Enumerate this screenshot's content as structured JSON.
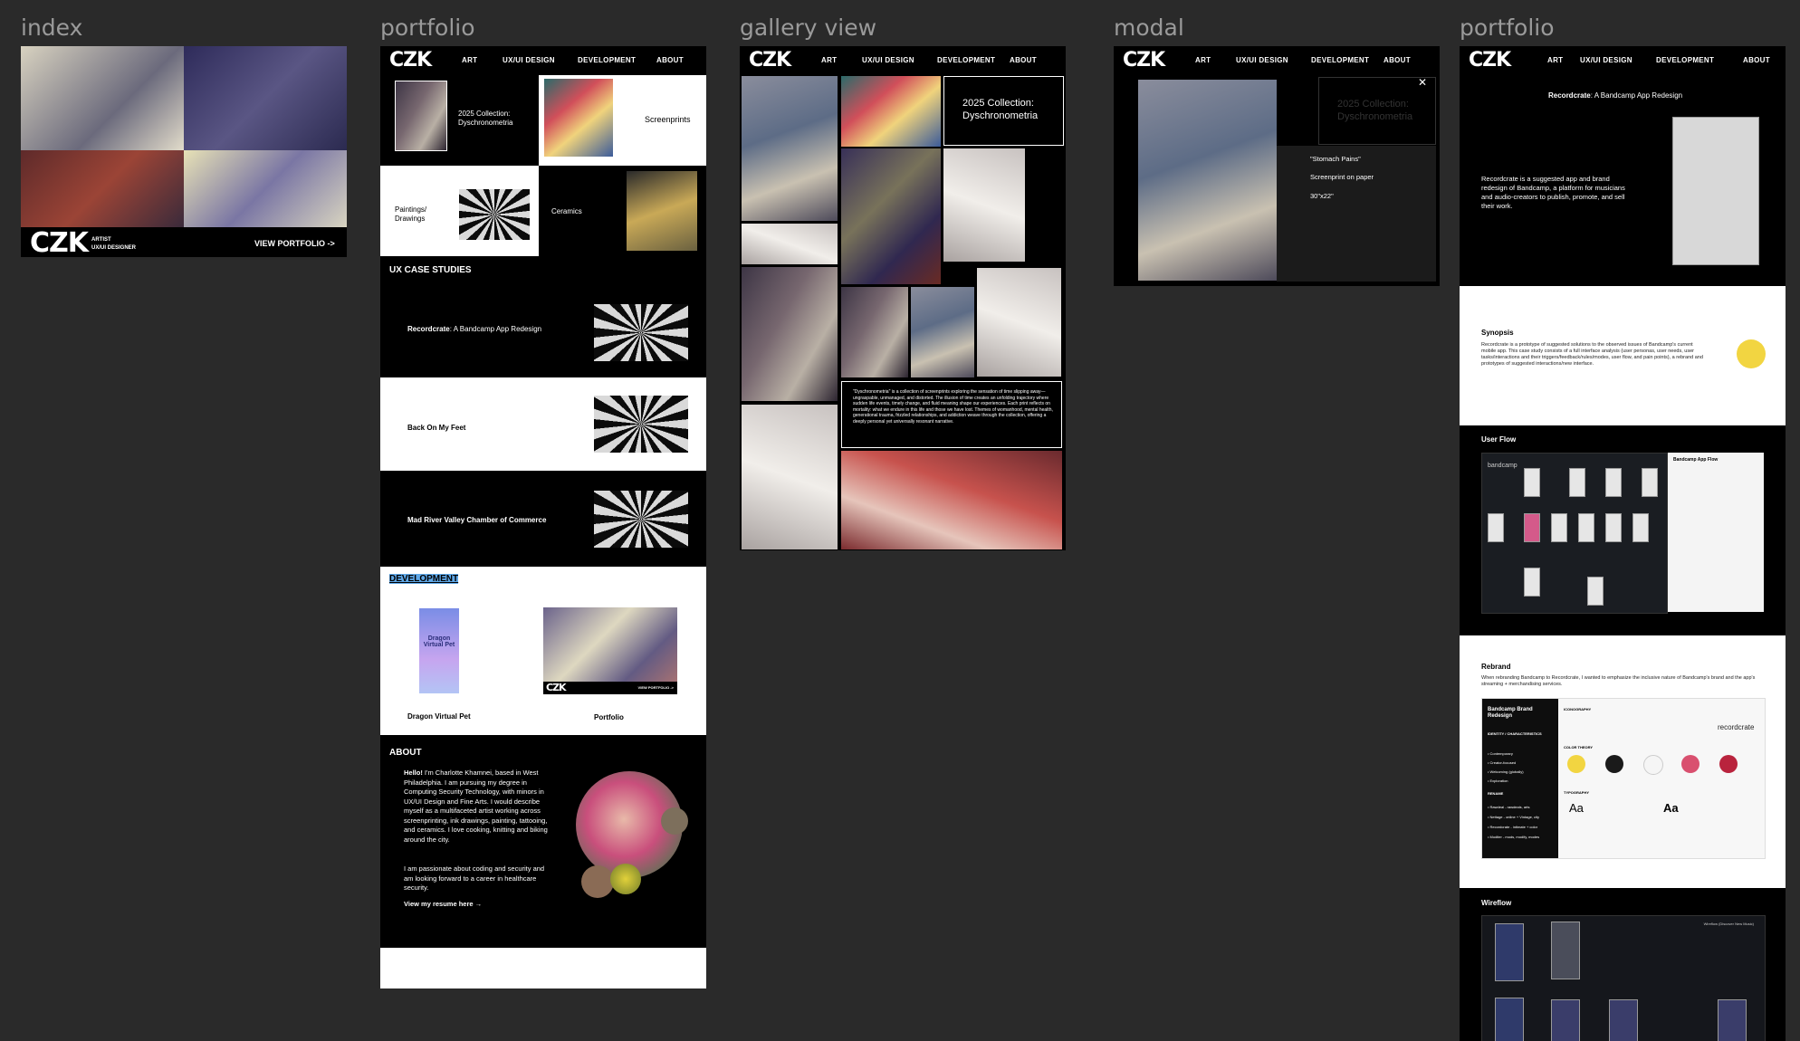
{
  "frames": {
    "index": "index",
    "portfolio": "portfolio",
    "gallery": "gallery view",
    "modal": "modal",
    "portfolio2": "portfolio"
  },
  "brand": {
    "logo": "CZK",
    "role1": "ARTIST",
    "role2": "UX/UI DESIGNER",
    "cta": "VIEW PORTFOLIO ->"
  },
  "nav": {
    "art": "ART",
    "ux": "UX/UI DESIGN",
    "dev": "DEVELOPMENT",
    "about": "ABOUT"
  },
  "portfolio": {
    "collection": "2025 Collection: Dyschronometria",
    "screenprints": "Screenprints",
    "paintings": "Paintings/ Drawings",
    "ceramics": "Ceramics",
    "ux_heading": "UX CASE STUDIES",
    "case1_bold": "Recordcrate",
    "case1_rest": ": A Bandcamp App Redesign",
    "case2": "Back On My Feet",
    "case3": "Mad River Valley Chamber of Commerce",
    "dev_heading": "DEVELOPMENT",
    "dev1": "Dragon Virtual Pet",
    "dev1_art": "Dragon Virtual Pet",
    "dev2": "Portfolio",
    "about_heading": "ABOUT",
    "about_hello": "Hello!",
    "about_p1": " I'm Charlotte Khamnei, based in West Philadelphia. I am pursuing my degree in Computing Security Technology, with minors in UX/UI Design and Fine Arts. I would describe myself as a multifaceted artist working across screenprinting, ink drawings, painting, tattooing, and ceramics. I love cooking, knitting and biking around the city.",
    "about_p2": "I am passionate about coding and security and am looking forward to a career in healthcare security.",
    "resume": "View my resume here →"
  },
  "gallery": {
    "title": "2025 Collection: Dyschronometria",
    "description": "\"Dyschronometria\" is a collection of screenprints exploring the sensation of time slipping away—ungraspable, unmanaged, and distorted. The illusion of time creates an unfolding trajectory where sudden life events, timely change, and fluid meaning shape our experiences. Each print reflects on mortality: what we endure in this life and those we have lost. Themes of womanhood, mental health, generational trauma, frizzled relationships, and addiction weave through the collection, offering a deeply personal yet universally resonant narrative."
  },
  "modal": {
    "ghost_title": "2025 Collection: Dyschronometria",
    "title": "\"Stomach Pains\"",
    "medium": "Screenprint on paper",
    "size": "30\"x22\"",
    "close": "✕"
  },
  "case": {
    "title_bold": "Recordcrate",
    "title_rest": ": A Bandcamp App Redesign",
    "intro": "Recordcrate is a suggested app and brand redesign of Bandcamp, a platform for musicians and audio-creators to publish, promote, and sell their work.",
    "synopsis_h": "Synopsis",
    "synopsis": "Recordcrate is a prototype of suggested solutions to the observed issues of Bandcamp's current mobile app. This case study consists of a full interface analysis (user personas, user needs, user tasks/interactions and their triggers/feedback/rules/modes, user flow, and pain points), a rebrand and prototypes of suggested interactions/new interface.",
    "userflow_h": "User Flow",
    "bc_logo": "bandcamp",
    "app_flow_h": "Bandcamp App Flow",
    "rebrand_h": "Rebrand",
    "rebrand": "When rebranding Bandcamp to Recordcrate, I wanted to emphasize the inclusive nature of Bandcamp's brand and the app's streaming + merchandising services.",
    "brand_h": "Bandcamp Brand Redesign",
    "identity": "IDENTITY / CHARACTERISTICS",
    "traits": [
      "• Contemporary",
      "• Creator-focused",
      "• Welcoming (globally)",
      "• Exploration"
    ],
    "rename": "RENAME",
    "names": [
      "• Rawdeal - rawdeals, arts",
      "• Nettage - online + Vintage, city",
      "• Recordcrate - intimate + color",
      "• Moditer - mods, modify, modes"
    ],
    "iconography": "ICONOGRAPHY",
    "rc_logo": "recordcrate",
    "color_theory": "COLOR THEORY",
    "typography": "TYPOGRAPHY",
    "aa": "Aa",
    "wireflow_h": "Wireflow",
    "wireflow_note": "Wireflow (Discover New Music)"
  },
  "colors": {
    "yellow": "#f2d541",
    "black": "#1a1a1a",
    "white": "#f5f5f5",
    "pink": "#d9506f",
    "red": "#b9233d"
  },
  "icons": [
    "close-icon",
    "arrow-right-icon"
  ]
}
